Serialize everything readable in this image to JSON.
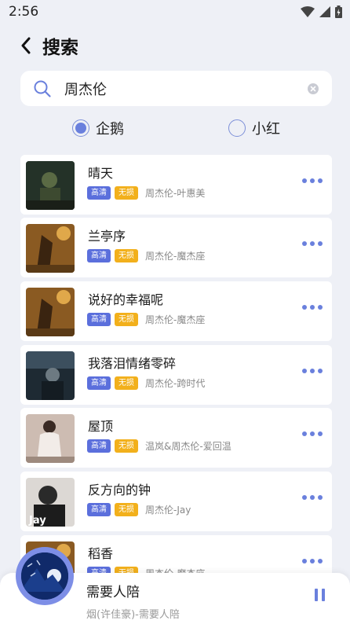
{
  "status_bar": {
    "time": "2:56"
  },
  "header": {
    "title": "搜索"
  },
  "search": {
    "query": "周杰伦"
  },
  "sources": [
    {
      "label": "企鹅",
      "selected": true
    },
    {
      "label": "小红",
      "selected": false
    }
  ],
  "tag_labels": {
    "hq": "高清",
    "lossless": "无损"
  },
  "songs": [
    {
      "title": "晴天",
      "meta": "周杰伦-叶惠美",
      "cover_color": "#2a3a2c"
    },
    {
      "title": "兰亭序",
      "meta": "周杰伦-魔杰座",
      "cover_color": "#8a5a22"
    },
    {
      "title": "说好的幸福呢",
      "meta": "周杰伦-魔杰座",
      "cover_color": "#8a5a22"
    },
    {
      "title": "我落泪情绪零碎",
      "meta": "周杰伦-跨时代",
      "cover_color": "#1e2a33"
    },
    {
      "title": "屋顶",
      "meta": "温岚&周杰伦-爱回温",
      "cover_color": "#c9b8b0"
    },
    {
      "title": "反方向的钟",
      "meta": "周杰伦-Jay",
      "cover_color": "#2b2b2b"
    },
    {
      "title": "稻香",
      "meta": "周杰伦-魔杰座",
      "cover_color": "#8a5a22"
    }
  ],
  "player": {
    "title": "需要人陪",
    "subtitle": "烟(许佳豪)-需要人陪"
  },
  "colors": {
    "accent": "#6a80dd",
    "tag_hq": "#5b6fdc",
    "tag_lossless": "#f2b01c",
    "background": "#eef0f6"
  }
}
